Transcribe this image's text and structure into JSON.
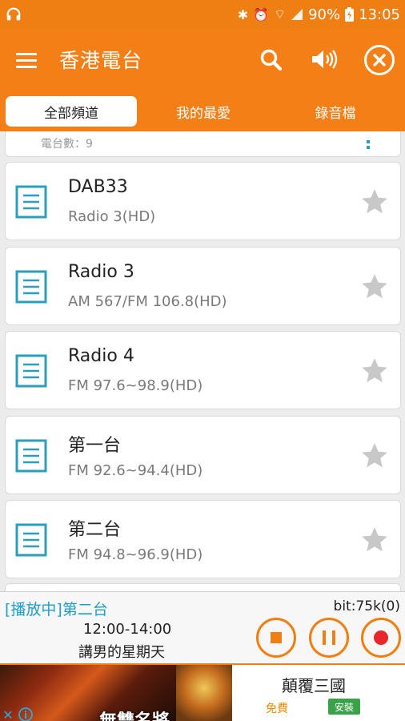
{
  "status_bar": {
    "battery": "90%",
    "time": "13:05",
    "icons": [
      "headset-icon",
      "bluetooth-icon",
      "alarm-icon",
      "wifi-icon",
      "signal-icon",
      "battery-icon"
    ]
  },
  "app_bar": {
    "title": "香港電台",
    "icons": [
      "menu-icon",
      "search-icon",
      "volume-icon",
      "close-icon"
    ]
  },
  "tabs": [
    {
      "label": "全部頻道",
      "active": true
    },
    {
      "label": "我的最愛",
      "active": false
    },
    {
      "label": "錄音檔",
      "active": false
    }
  ],
  "list_header_partial": "電台數：9",
  "stations": [
    {
      "name": "DAB33",
      "freq": "Radio 3(HD)"
    },
    {
      "name": "Radio 3",
      "freq": "AM 567/FM 106.8(HD)"
    },
    {
      "name": "Radio 4",
      "freq": "FM 97.6~98.9(HD)"
    },
    {
      "name": "第一台",
      "freq": "FM 92.6~94.4(HD)"
    },
    {
      "name": "第二台",
      "freq": "FM 94.8~96.9(HD)"
    }
  ],
  "player": {
    "now_playing": "[播放中]第二台",
    "bitrate": "bit:75k(0)",
    "time_slot": "12:00-14:00",
    "program": "講男的星期天"
  },
  "ad": {
    "title": "顛覆三國",
    "free_label": "免費",
    "install_label": "安裝",
    "overlay_text": "無雙名將"
  },
  "colors": {
    "accent": "#f57f17",
    "status_bar": "#f07f13",
    "now_playing": "#1e9ec8",
    "record": "#e8262b",
    "doc_icon": "#2a9fbd",
    "star": "#c8c8c8"
  }
}
